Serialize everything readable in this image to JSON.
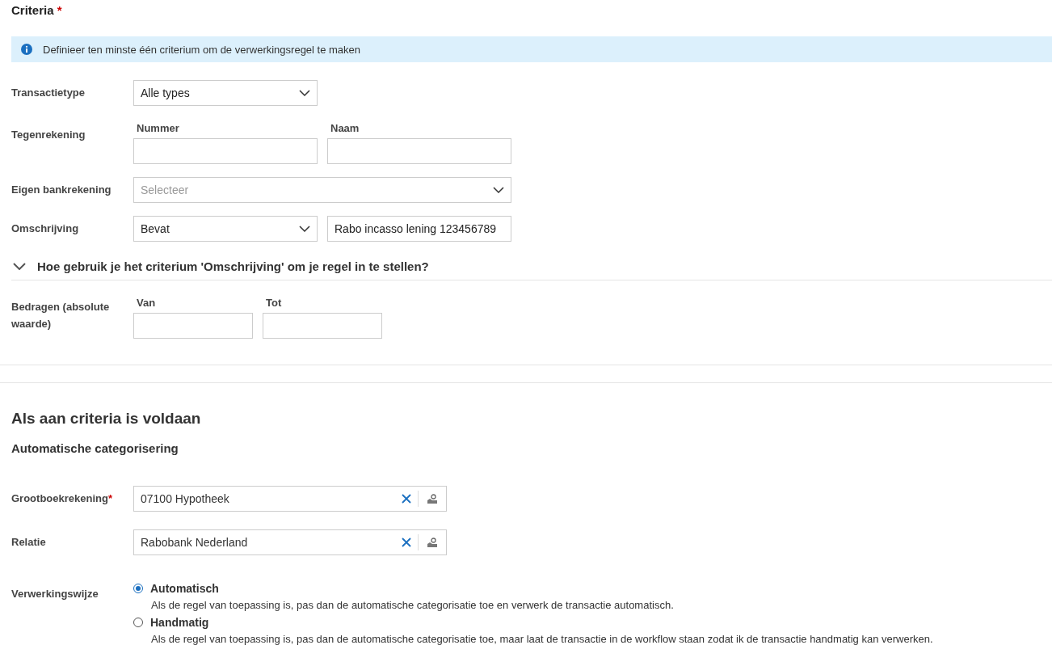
{
  "criteria": {
    "title": "Criteria",
    "required_mark": "*",
    "info": "Definieer ten minste één criterium om de verwerkingsregel te maken",
    "transaction_type": {
      "label": "Transactietype",
      "value": "Alle types"
    },
    "counter_account": {
      "label": "Tegenrekening",
      "number": {
        "label": "Nummer"
      },
      "name": {
        "label": "Naam"
      }
    },
    "own_account": {
      "label": "Eigen bankrekening",
      "placeholder": "Selecteer"
    },
    "description": {
      "label": "Omschrijving",
      "operator": "Bevat",
      "value": "Rabo incasso lening 123456789"
    },
    "help": {
      "title": "Hoe gebruik je het criterium 'Omschrijving' om je regel in te stellen?"
    },
    "amounts": {
      "label": "Bedragen (absolute waarde)",
      "from": {
        "label": "Van"
      },
      "to": {
        "label": "Tot"
      }
    }
  },
  "action": {
    "title": "Als aan criteria is voldaan",
    "subtitle": "Automatische categorisering",
    "ledger": {
      "label": "Grootboekrekening",
      "required_mark": "*",
      "value": "07100 Hypotheek"
    },
    "relation": {
      "label": "Relatie",
      "value": "Rabobank Nederland"
    },
    "processing": {
      "label": "Verwerkingswijze",
      "options": [
        {
          "label": "Automatisch",
          "description": "Als de regel van toepassing is, pas dan de automatische categorisatie toe en verwerk de transactie automatisch.",
          "selected": true
        },
        {
          "label": "Handmatig",
          "description": "Als de regel van toepassing is, pas dan de automatische categorisatie toe, maar laat de transactie in de workflow staan zodat ik de transactie handmatig kan verwerken.",
          "selected": false
        }
      ]
    }
  }
}
